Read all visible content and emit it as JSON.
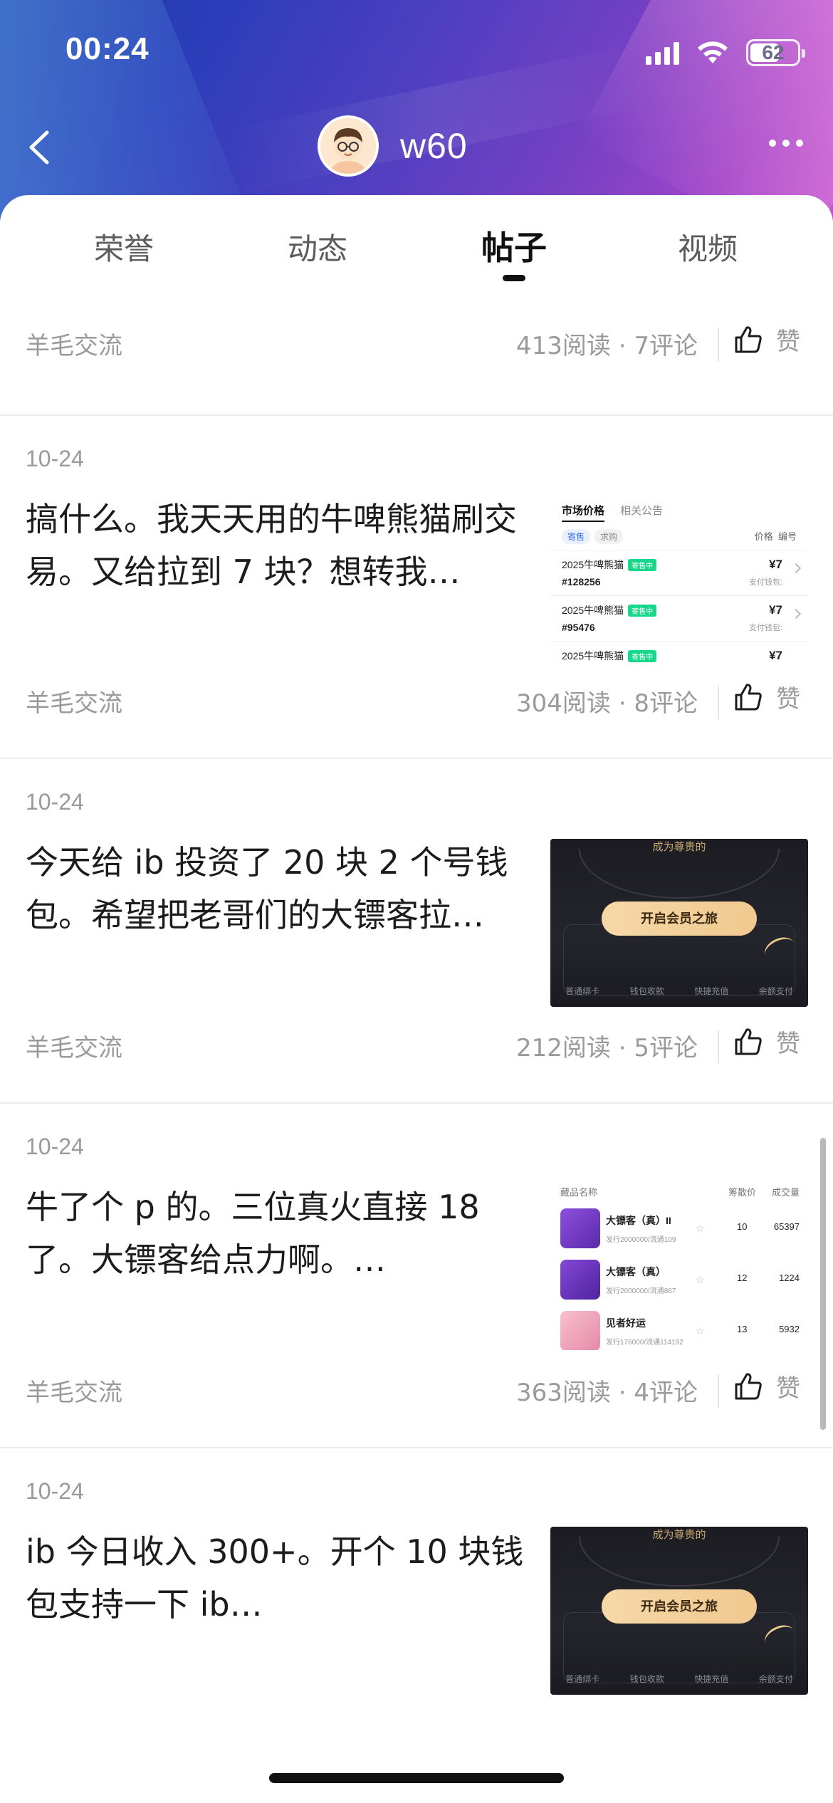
{
  "status_bar": {
    "time": "00:24",
    "battery": "62"
  },
  "profile": {
    "username": "w60"
  },
  "tabs": [
    {
      "label": "荣誉",
      "active": false
    },
    {
      "label": "动态",
      "active": false
    },
    {
      "label": "帖子",
      "active": true
    },
    {
      "label": "视频",
      "active": false
    }
  ],
  "thumbs": {
    "market": {
      "tab_price": "市场价格",
      "tab_notice": "相关公告",
      "filter_sell": "寄售",
      "filter_buy": "求购",
      "col_price": "价格",
      "col_id": "编号",
      "tag": "寄售中",
      "pay_label": "支付钱包:",
      "rows": [
        {
          "name": "2025牛啤熊猫",
          "id": "#128256",
          "price": "¥7"
        },
        {
          "name": "2025牛啤熊猫",
          "id": "#95476",
          "price": "¥7"
        },
        {
          "name": "2025牛啤熊猫",
          "id": "",
          "price": "¥7"
        }
      ]
    },
    "membership": {
      "banner": "成为尊贵的",
      "cta": "开启会员之旅",
      "menu": [
        "普通绑卡",
        "钱包收款",
        "快捷充值",
        "余额支付"
      ]
    },
    "rank": {
      "col_name": "藏品名称",
      "col_a": "筹散价",
      "col_b": "成交量",
      "items": [
        {
          "name": "大镖客（真）II",
          "sub": "发行2000000/流通109",
          "a": "10",
          "b": "65397",
          "color": "#7a3fd1"
        },
        {
          "name": "大镖客（真）",
          "sub": "发行2000000/流通867",
          "a": "12",
          "b": "1224",
          "color": "#6f38c8"
        },
        {
          "name": "见者好运",
          "sub": "发行176000/流通114192",
          "a": "13",
          "b": "5932",
          "color": "#f3a6b8"
        }
      ]
    }
  },
  "posts": [
    {
      "date": "",
      "text": "",
      "category": "羊毛交流",
      "reads": "413",
      "comments": "7",
      "read_label": "阅读",
      "comment_label": "评论",
      "like_label": "赞"
    },
    {
      "date": "10-24",
      "text": "搞什么。我天天用的牛啤熊猫刷交易。又给拉到 7 块？想转我…",
      "category": "羊毛交流",
      "reads": "304",
      "comments": "8",
      "read_label": "阅读",
      "comment_label": "评论",
      "like_label": "赞"
    },
    {
      "date": "10-24",
      "text": "今天给 ib 投资了 20 块 2 个号钱包。希望把老哥们的大镖客拉…",
      "category": "羊毛交流",
      "reads": "212",
      "comments": "5",
      "read_label": "阅读",
      "comment_label": "评论",
      "like_label": "赞"
    },
    {
      "date": "10-24",
      "text": "牛了个 p 的。三位真火直接 18 了。大镖客给点力啊。…",
      "category": "羊毛交流",
      "reads": "363",
      "comments": "4",
      "read_label": "阅读",
      "comment_label": "评论",
      "like_label": "赞"
    },
    {
      "date": "10-24",
      "text": "ib 今日收入 300+。开个 10 块钱包支持一下 ib…",
      "category": "",
      "reads": "",
      "comments": "",
      "read_label": "",
      "comment_label": "",
      "like_label": ""
    }
  ],
  "colors": {
    "accent": "#111111",
    "muted": "#9a9a9e",
    "tag_green": "#18d68a"
  }
}
